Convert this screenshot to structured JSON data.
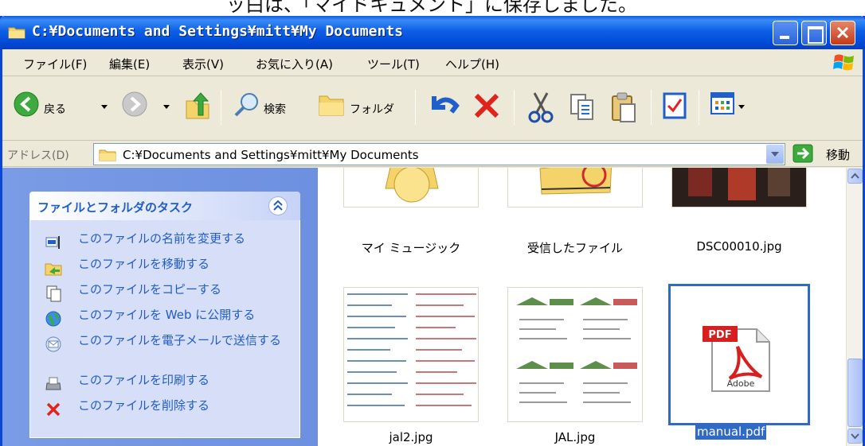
{
  "caption": "　ッ白は、「マイドキュメント」に保存しました。",
  "window": {
    "title": "C:¥Documents and Settings¥mitt¥My Documents"
  },
  "menu": [
    "ファイル(F)",
    "編集(E)",
    "表示(V)",
    "お気に入り(A)",
    "ツール(T)",
    "ヘルプ(H)"
  ],
  "toolbar": {
    "back_label": "戻る",
    "search_label": "検索",
    "folders_label": "フォルダ"
  },
  "address": {
    "label": "アドレス(D)",
    "value": "C:¥Documents and Settings¥mitt¥My Documents",
    "go_label": "移動"
  },
  "tasks": {
    "title": "ファイルとフォルダのタスク",
    "items": [
      "このファイルの名前を変更する",
      "このファイルを移動する",
      "このファイルをコピーする",
      "このファイルを Web に公開する",
      "このファイルを電子メールで送信する",
      "このファイルを印刷する",
      "このファイルを削除する"
    ]
  },
  "files": [
    {
      "name": "マイ ミュージック",
      "selected": false
    },
    {
      "name": "受信したファイル",
      "selected": false
    },
    {
      "name": "DSC00010.jpg",
      "selected": false
    },
    {
      "name": "jal2.jpg",
      "selected": false
    },
    {
      "name": "JAL.jpg",
      "selected": false
    },
    {
      "name": "manual.pdf",
      "selected": true
    }
  ],
  "pdf_icon_text": {
    "badge": "PDF",
    "brand": "Adobe"
  },
  "colors": {
    "titlebar": "#0047D4",
    "task_link": "#215DC6",
    "selection": "#316AC5",
    "taskpane_bg": "#7A9BE5"
  }
}
